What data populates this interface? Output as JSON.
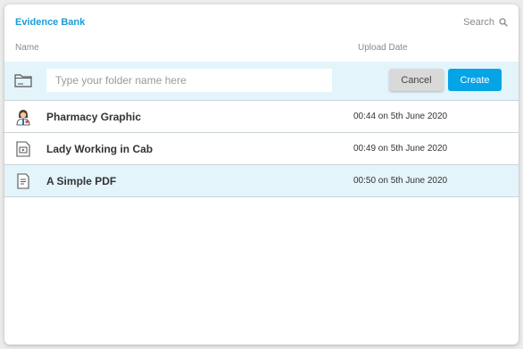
{
  "header": {
    "title": "Evidence Bank",
    "search_label": "Search"
  },
  "columns": {
    "name": "Name",
    "upload_date": "Upload Date"
  },
  "new_folder": {
    "placeholder": "Type your folder name here",
    "value": "",
    "cancel_label": "Cancel",
    "create_label": "Create",
    "icon": "folder-icon"
  },
  "files": [
    {
      "name": "Pharmacy Graphic",
      "date": "00:44 on 5th June 2020",
      "icon": "pharmacist-image-icon",
      "selected": false
    },
    {
      "name": "Lady Working in Cab",
      "date": "00:49 on 5th June 2020",
      "icon": "video-file-icon",
      "selected": false
    },
    {
      "name": "A Simple PDF",
      "date": "00:50 on 5th June 2020",
      "icon": "document-file-icon",
      "selected": true
    }
  ],
  "colors": {
    "accent": "#1a9cd8",
    "create_button": "#05a4e6",
    "row_highlight": "#e3f4fb",
    "cancel_button": "#d9d9d9"
  }
}
